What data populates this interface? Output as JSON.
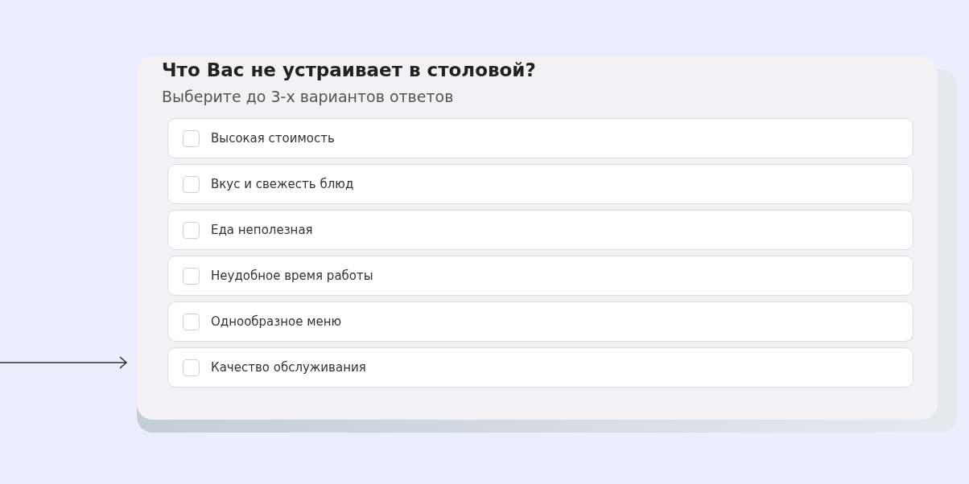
{
  "question": {
    "title": "Что Вас не устраивает в столовой?",
    "subtitle": "Выберите до 3-х вариантов ответов"
  },
  "options": [
    {
      "label": "Высокая стоимость",
      "checked": false
    },
    {
      "label": "Вкус и свежесть блюд",
      "checked": false
    },
    {
      "label": "Еда неполезная",
      "checked": false
    },
    {
      "label": "Неудобное время работы",
      "checked": false
    },
    {
      "label": "Однообразное меню",
      "checked": false
    },
    {
      "label": "Качество обслуживания",
      "checked": false
    }
  ]
}
